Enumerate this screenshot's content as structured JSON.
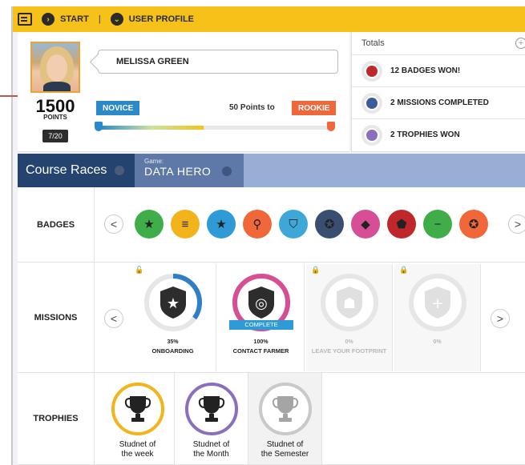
{
  "topbar": {
    "start_label": "START",
    "separator": "|",
    "profile_label": "USER PROFILE"
  },
  "profile": {
    "name": "MELISSA GREEN",
    "points": "1500",
    "points_label": "POINTS",
    "level": "7/20",
    "current_rank": "NOVICE",
    "points_to_text": "50 Points to",
    "next_rank": "ROOKIE",
    "progress_fraction": 0.45
  },
  "totals": {
    "title": "Totals",
    "plus_label": "+",
    "items": [
      {
        "label": "12 BADGES WON!",
        "ring": "#e8e8e8",
        "inner": "#c0272d"
      },
      {
        "label": "2 MISSIONS COMPLETED",
        "ring": "#e8e8e8",
        "inner": "#3c5b9a"
      },
      {
        "label": "2 TROPHIES WON",
        "ring": "#e8e8e8",
        "inner": "#8a6fbf"
      }
    ]
  },
  "course": {
    "tab_label": "Course Races",
    "game_caption": "Game:",
    "game_name": "DATA HERO"
  },
  "badges": {
    "label": "BADGES",
    "prev": "<",
    "next": ">",
    "items": [
      {
        "icon": "star-badge-icon",
        "color": "#3fae49",
        "glyph": "★"
      },
      {
        "icon": "stripes-badge-icon",
        "color": "#f2b31b",
        "glyph": "≡"
      },
      {
        "icon": "star-badge-icon",
        "color": "#2f9bd6",
        "glyph": "★"
      },
      {
        "icon": "magnifier-badge-icon",
        "color": "#f0673a",
        "glyph": "⚲"
      },
      {
        "icon": "lock-badge-icon",
        "color": "#3da8d8",
        "glyph": "⛉"
      },
      {
        "icon": "award-badge-icon",
        "color": "#3a4f70",
        "glyph": "✪"
      },
      {
        "icon": "tag-badge-icon",
        "color": "#d64f94",
        "glyph": "◆"
      },
      {
        "icon": "shield-badge-icon",
        "color": "#c0272d",
        "glyph": "⬟"
      },
      {
        "icon": "minus-badge-icon",
        "color": "#3fae49",
        "glyph": "−"
      },
      {
        "icon": "star-badge-icon",
        "color": "#f0673a",
        "glyph": "✪"
      }
    ]
  },
  "missions": {
    "label": "MISSIONS",
    "prev": "<",
    "next": ">",
    "items": [
      {
        "percent": "35%",
        "name": "ONBOARDING",
        "progress": 0.35,
        "locked": false,
        "complete": false,
        "ring_color": "#2f7fc4",
        "icon": "star-shield-icon",
        "glyph": "★"
      },
      {
        "percent": "100%",
        "name": "CONTACT FARMER",
        "progress": 1.0,
        "locked": false,
        "complete": true,
        "complete_label": "COMPLETE",
        "ring_color": "#d64f94",
        "icon": "fingerprint-shield-icon",
        "glyph": "◎"
      },
      {
        "percent": "0%",
        "name": "LEAVE YOUR FOOTPRINT",
        "progress": 0,
        "locked": true,
        "complete": false,
        "ring_color": "#cccccc",
        "icon": "footprint-icon",
        "glyph": "☗"
      },
      {
        "percent": "0%",
        "name": "",
        "progress": 0,
        "locked": true,
        "complete": false,
        "ring_color": "#cccccc",
        "icon": "plus-shield-icon",
        "glyph": "+"
      }
    ]
  },
  "trophies": {
    "label": "TROPHIES",
    "items": [
      {
        "line1": "Studnet of",
        "line2": "the week",
        "ring": "#f2b31b",
        "glyph_color": "#222"
      },
      {
        "line1": "Studnet of",
        "line2": "the Month",
        "ring": "#8a6fbf",
        "glyph_color": "#222"
      },
      {
        "line1": "Studnet of",
        "line2": "the Semester",
        "ring": "#c9c9c9",
        "glyph_color": "#a5a5a5"
      }
    ]
  }
}
